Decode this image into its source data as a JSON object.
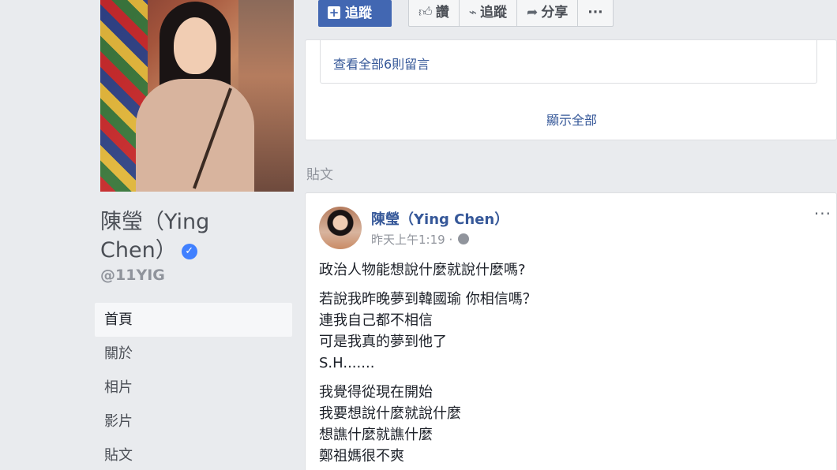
{
  "page": {
    "name": "陳瑩（Ying Chen）",
    "handle": "@11YIG"
  },
  "nav": {
    "items": [
      {
        "label": "首頁",
        "active": true
      },
      {
        "label": "關於"
      },
      {
        "label": "相片"
      },
      {
        "label": "影片"
      },
      {
        "label": "貼文"
      }
    ]
  },
  "actions": {
    "follow_primary": "追蹤",
    "like": "讚",
    "follow": "追蹤",
    "share": "分享",
    "more": "···"
  },
  "comments": {
    "view_all": "查看全部6則留言",
    "show_all": "顯示全部"
  },
  "posts_section": {
    "label": "貼文"
  },
  "post": {
    "author": "陳瑩（Ying Chen）",
    "time": "昨天上午1:19 · ",
    "menu": "···",
    "paragraphs": [
      [
        "政治人物能想說什麼就說什麼嗎?"
      ],
      [
        "若說我昨晚夢到韓國瑜 你相信嗎？",
        "連我自己都不相信",
        "可是我真的夢到他了",
        "S.H......."
      ],
      [
        "我覺得從現在開始",
        "我要想說什麼就說什麼",
        "想譙什麼就譙什麼",
        "鄭祖媽很不爽"
      ]
    ]
  },
  "colors": {
    "fb_blue": "#4267b2",
    "link": "#365899",
    "background": "#e9ebee",
    "verified": "#4080ff"
  }
}
